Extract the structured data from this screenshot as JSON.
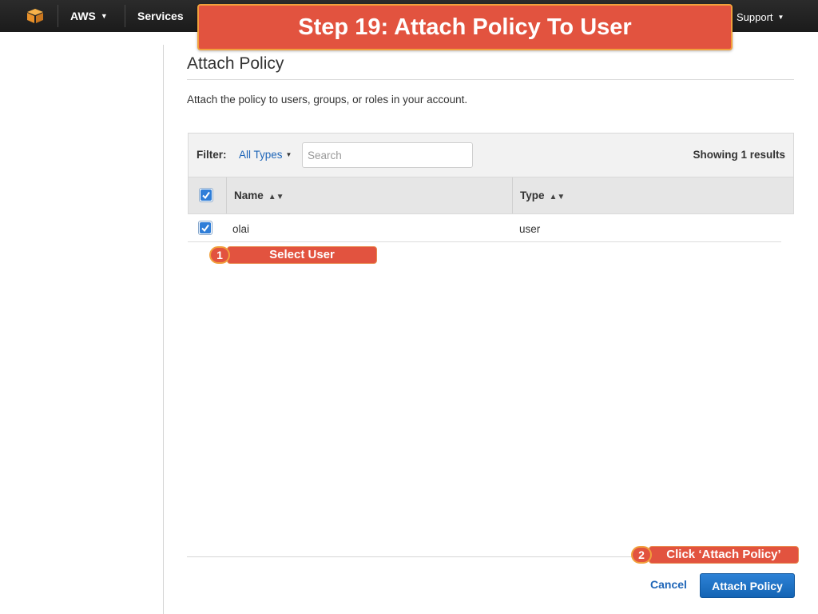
{
  "topbar": {
    "brand_label": "AWS",
    "services_label": "Services",
    "support_label": "Support",
    "logo_icon": "aws-cube-icon",
    "logo_color": "#f5a623"
  },
  "banner": {
    "text": "Step 19: Attach Policy To User",
    "color": "#e2533f"
  },
  "page": {
    "title": "Attach Policy",
    "description": "Attach the policy to users, groups, or roles in your account."
  },
  "filter": {
    "label": "Filter:",
    "type_selected": "All Types",
    "search_placeholder": "Search",
    "results_text": "Showing 1 results"
  },
  "table": {
    "columns": [
      "Name",
      "Type"
    ],
    "header_checked": true,
    "rows": [
      {
        "checked": true,
        "name": "olai",
        "type": "user"
      }
    ]
  },
  "callouts": [
    {
      "number": "1",
      "label": "Select User"
    },
    {
      "number": "2",
      "label": "Click ‘Attach Policy’"
    }
  ],
  "footer": {
    "cancel_label": "Cancel",
    "attach_label": "Attach Policy",
    "accent": "#1f66b8"
  }
}
